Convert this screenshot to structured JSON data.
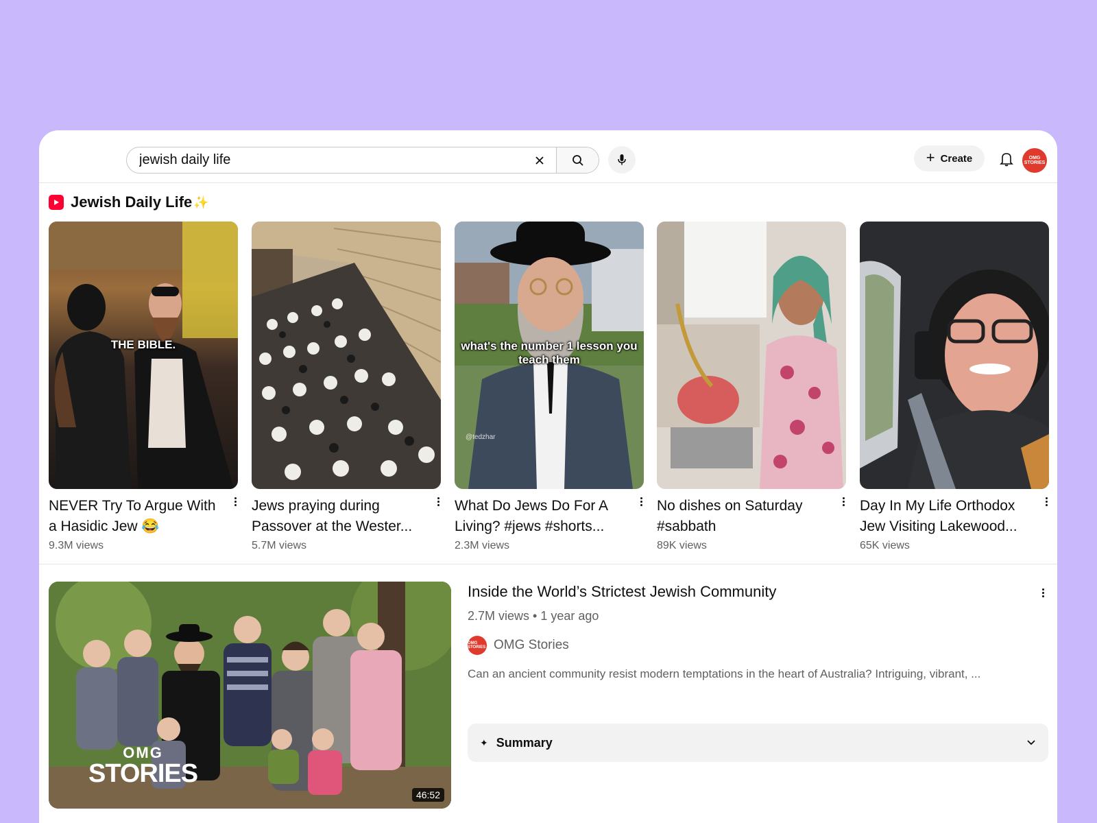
{
  "search": {
    "query": "jewish daily life",
    "clear_icon": "close-icon",
    "search_icon": "search-icon",
    "mic_icon": "mic-icon"
  },
  "header": {
    "create_label": "Create",
    "avatar_text": "OMG STORIES"
  },
  "shelf": {
    "title": "Jewish Daily Life",
    "sparkle": "✨",
    "items": [
      {
        "title": "NEVER Try To Argue With a Hasidic Jew 😂",
        "views": "9.3M views",
        "caption": "THE BIBLE."
      },
      {
        "title": "Jews praying during Passover at the Wester...",
        "views": "5.7M views",
        "caption": ""
      },
      {
        "title": "What Do Jews Do For A Living? #jews #shorts...",
        "views": "2.3M views",
        "caption": "what's the number 1 lesson you teach them",
        "handle": "@tedzhar"
      },
      {
        "title": "No dishes on Saturday #sabbath",
        "views": "89K views",
        "caption": ""
      },
      {
        "title": "Day In My Life Orthodox Jew Visiting Lakewood...",
        "views": "65K views",
        "caption": ""
      }
    ]
  },
  "video": {
    "title": "Inside the World’s Strictest Jewish Community",
    "meta": "2.7M views • 1 year ago",
    "channel": "OMG Stories",
    "channel_avatar_text": "OMG STORIES",
    "description": "Can an ancient community resist modern temptations in the heart of Australia? Intriguing, vibrant, ...",
    "duration": "46:52",
    "thumb_logo_small": "OMG",
    "thumb_logo_big": "STORIES",
    "summary_label": "Summary"
  },
  "colors": {
    "background": "#c9b8fb",
    "brand_red": "#ff0033",
    "avatar_red": "#e03a2c"
  }
}
